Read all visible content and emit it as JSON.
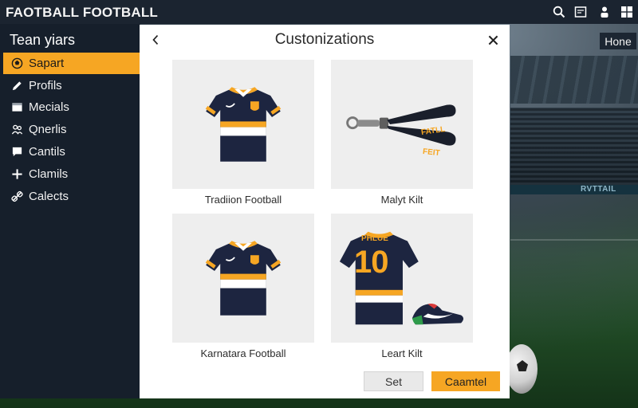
{
  "app": {
    "title": "FAOTBALL FOOTBALL"
  },
  "topbar_icons": [
    "search-icon",
    "news-icon",
    "profile-icon",
    "windows-icon"
  ],
  "sidebar": {
    "title": "Tean yiars",
    "items": [
      {
        "label": "Sapart",
        "icon": "ball-icon",
        "active": true
      },
      {
        "label": "Profils",
        "icon": "pencil-icon",
        "active": false
      },
      {
        "label": "Mecials",
        "icon": "card-icon",
        "active": false
      },
      {
        "label": "Qnerlis",
        "icon": "people-icon",
        "active": false
      },
      {
        "label": "Cantils",
        "icon": "chat-icon",
        "active": false
      },
      {
        "label": "Clamils",
        "icon": "plus-icon",
        "active": false
      },
      {
        "label": "Calects",
        "icon": "link-icon",
        "active": false
      }
    ]
  },
  "home_chip": {
    "label": "Hone"
  },
  "modal": {
    "title": "Custonizations",
    "cards": [
      {
        "label": "Tradiion Football",
        "image": "striped-jersey-front"
      },
      {
        "label": "Malyt Kilt",
        "image": "lanyard-keychain",
        "lanyard_text_1": "FATLL",
        "lanyard_text_2": "FEIT"
      },
      {
        "label": "Karnatara Football",
        "image": "striped-jersey-front"
      },
      {
        "label": "Leart Kilt",
        "image": "jersey-back-with-shoe",
        "jersey_name": "PHLUE",
        "jersey_number": "10"
      }
    ],
    "buttons": {
      "set": "Set",
      "cancel": "Caamtel"
    }
  },
  "background": {
    "ad_text": "RVTTAIL"
  },
  "colors": {
    "accent": "#f6a623",
    "navy": "#1d2540",
    "sidebar": "#161f2b"
  }
}
